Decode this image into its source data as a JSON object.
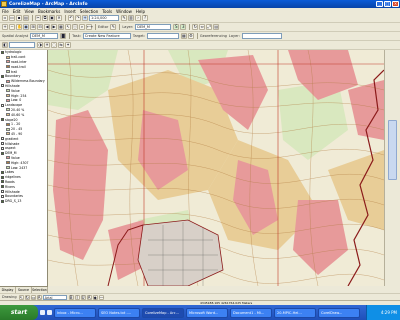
{
  "window": {
    "title": "CorelizeMap - ArcMap - ArcInfo",
    "controls": [
      "_",
      "□",
      "×"
    ]
  },
  "menu": [
    "File",
    "Edit",
    "View",
    "Bookmarks",
    "Insert",
    "Selection",
    "Tools",
    "Window",
    "Help"
  ],
  "toolbars": {
    "scale": "1:24,000",
    "editor_label": "Editor",
    "task_label": "Task:",
    "task_value": "Create New Feature",
    "target_label": "Target:",
    "layer_combo": "Layer:",
    "layer_value": "DEM_M",
    "spatial_label": "Spatial Analyst",
    "georef_label": "Georeferencing",
    "layer2_label": "Layer:"
  },
  "toc": {
    "layers": [
      {
        "label": "hydrologic",
        "checked": true,
        "indent": false
      },
      {
        "label": "trail-cont",
        "checked": true,
        "indent": true
      },
      {
        "label": "road-inter",
        "checked": true,
        "indent": true
      },
      {
        "label": "road-trail",
        "checked": true,
        "indent": true
      },
      {
        "label": "trail",
        "checked": true,
        "indent": true
      },
      {
        "label": "Boundary",
        "checked": true,
        "indent": false
      },
      {
        "label": "Wilderness Boundary",
        "checked": true,
        "indent": true
      },
      {
        "label": "Hillshade",
        "checked": false,
        "indent": false
      },
      {
        "label": "Value",
        "checked": false,
        "indent": true
      },
      {
        "label": "High: 254",
        "checked": false,
        "indent": true
      },
      {
        "label": "Low: 0",
        "checked": false,
        "indent": true
      },
      {
        "label": "Landscape",
        "checked": false,
        "indent": false
      },
      {
        "label": "20-40 %",
        "checked": true,
        "indent": true
      },
      {
        "label": "40-60 %",
        "checked": true,
        "indent": true
      },
      {
        "label": "slope20",
        "checked": true,
        "indent": false
      },
      {
        "label": "1 - 20",
        "checked": true,
        "indent": true
      },
      {
        "label": "20 - 45",
        "checked": true,
        "indent": true
      },
      {
        "label": "45 - 90",
        "checked": true,
        "indent": true
      },
      {
        "label": "gradient",
        "checked": false,
        "indent": false
      },
      {
        "label": "hillshade",
        "checked": false,
        "indent": false
      },
      {
        "label": "aspect",
        "checked": false,
        "indent": false
      },
      {
        "label": "DEM_M",
        "checked": true,
        "indent": false
      },
      {
        "label": "Value",
        "checked": false,
        "indent": true
      },
      {
        "label": "High: 4307",
        "checked": false,
        "indent": true
      },
      {
        "label": "Low: 2437",
        "checked": false,
        "indent": true
      },
      {
        "label": "Lakes",
        "checked": true,
        "indent": false
      },
      {
        "label": "ridgelines",
        "checked": true,
        "indent": false
      },
      {
        "label": "Roads",
        "checked": true,
        "indent": false
      },
      {
        "label": "Rivers",
        "checked": true,
        "indent": false
      },
      {
        "label": "Hillshade",
        "checked": false,
        "indent": false
      },
      {
        "label": "Boundaries",
        "checked": false,
        "indent": false
      },
      {
        "label": "DRG_S_13",
        "checked": true,
        "indent": false
      }
    ],
    "tabs": [
      "Display",
      "Source",
      "Selection"
    ]
  },
  "drawbar": {
    "drawing_label": "Drawing",
    "font_label": "Arial"
  },
  "statusbar": {
    "coords": "4345188.165 4261764.025 Meters"
  },
  "taskbar": {
    "start_label": "start",
    "tasks": [
      "Inbox - Micro...",
      "SEO Notes.txt -...",
      "CorelizeMap - Arc...",
      "Microsoft Word...",
      "Document1 - Mi...",
      "20-MPIC-Hel...",
      "CorelDraw..."
    ],
    "clock": "4:29 PM"
  },
  "colors": {
    "slope_steep": "#e89a9a",
    "slope_mid": "#e6c28c",
    "slope_low": "#cfe3b0",
    "contour": "#b07a3f",
    "boundary": "#8b1a1a",
    "grid": "#c0392b"
  }
}
